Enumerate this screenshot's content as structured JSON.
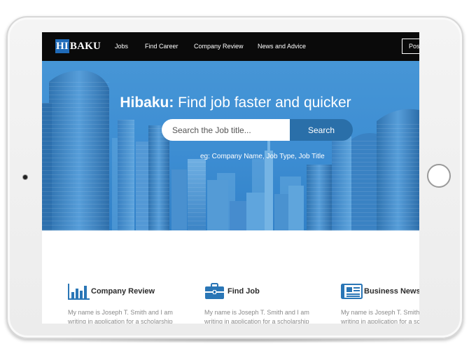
{
  "brand": {
    "logo_mark": "HI",
    "logo_rest": "BAKU",
    "accent_color": "#1f6ab8"
  },
  "nav": {
    "links": [
      "Jobs",
      "Find Career",
      "Company Review",
      "News and Advice"
    ],
    "post_label": "Pos"
  },
  "hero": {
    "title_brand": "Hibaku:",
    "title_rest": " Find job faster and quicker",
    "search_placeholder": "Search the Job title...",
    "search_button": "Search",
    "hint": "eg: Company Name, Job Type, Job Title"
  },
  "features": [
    {
      "icon": "bar-chart-icon",
      "title": "Company Review",
      "text": "My name is Joseph T. Smith and I am writing in application for a scholarship"
    },
    {
      "icon": "briefcase-icon",
      "title": "Find Job",
      "text": "My name is Joseph T. Smith and I am writing in application for a scholarship"
    },
    {
      "icon": "newspaper-icon",
      "title": "Business News",
      "text": "My name is Joseph T. Smith and I am writing in application for a scholarship"
    }
  ]
}
